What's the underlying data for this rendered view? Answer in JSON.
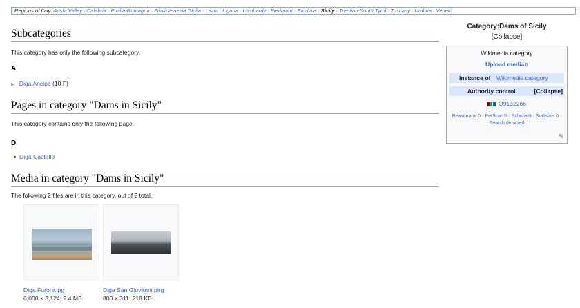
{
  "regions": {
    "label": "Regions of Italy:",
    "items": [
      "Aosta Valley",
      "Calabria",
      "Emilia-Romagna",
      "Friuli-Venezia Giulia",
      "Lazio",
      "Liguria",
      "Lombardy",
      "Piedmont",
      "Sardinia",
      "Sicily",
      "Trentino-South Tyrol",
      "Tuscany",
      "Umbria",
      "Veneto"
    ],
    "current": "Sicily"
  },
  "subcategories": {
    "heading": "Subcategories",
    "intro": "This category has only the following subcategory.",
    "letter": "A",
    "item_label": "Diga Ancipa",
    "item_count": "(10 F)"
  },
  "pages": {
    "heading": "Pages in category \"Dams in Sicily\"",
    "intro": "This category contains only the following page.",
    "letter": "D",
    "item_label": "Diga Castello"
  },
  "media": {
    "heading": "Media in category \"Dams in Sicily\"",
    "intro": "The following 2 files are in this category, out of 2 total.",
    "files": [
      {
        "name": "Diga Furore.jpg",
        "meta": "6,000 × 3,124; 2.4 MB"
      },
      {
        "name": "Diga San Giovanni.png",
        "meta": "800 × 311; 218 KB"
      }
    ]
  },
  "infobox": {
    "title": "Category:Dams of Sicily",
    "collapse": "[Collapse]",
    "type": "Wikimedia category",
    "upload": "Upload media",
    "instance_label": "Instance of",
    "instance_value": "Wikimedia category",
    "authority_label": "Authority control",
    "authority_collapse": "[Collapse]",
    "qid": "Q9132266",
    "tools": [
      "Reasonator",
      "PetScan",
      "Scholia",
      "Statistics",
      "Search depicted"
    ]
  },
  "icons": {
    "pencil": "pencil-icon",
    "external": "external-link-icon",
    "wikidata": "wikidata-barcode-icon",
    "triangle": "expand-triangle-icon"
  }
}
